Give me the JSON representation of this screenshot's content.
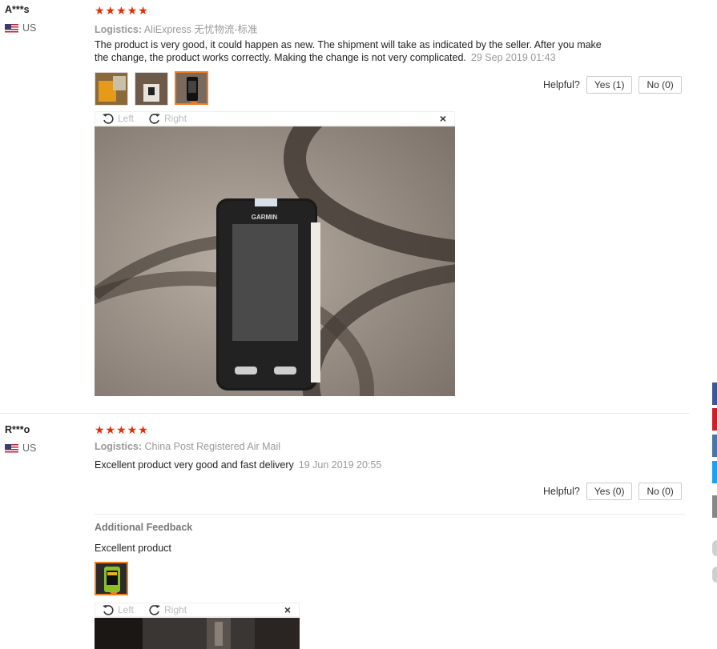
{
  "reviews": [
    {
      "user": "A***s",
      "country": "US",
      "stars": "★★★★★",
      "logistics_label": "Logistics:",
      "logistics_value": "AliExpress 无忧物流-标准",
      "text_line1": "The product is very good, it could happen as new. The shipment will take as indicated by the seller. After you make",
      "text_line2": "the change, the product works correctly. Making the change is not very complicated.",
      "date": "29 Sep 2019 01:43",
      "helpful_label": "Helpful?",
      "yes_label": "Yes (1)",
      "no_label": "No (0)",
      "rotate_left": "Left",
      "rotate_right": "Right",
      "close": "×"
    },
    {
      "user": "R***o",
      "country": "US",
      "stars": "★★★★★",
      "logistics_label": "Logistics:",
      "logistics_value": "China Post Registered Air Mail",
      "text": "Excellent product very good and fast delivery",
      "date": "19 Jun 2019 20:55",
      "helpful_label": "Helpful?",
      "yes_label": "Yes (0)",
      "no_label": "No (0)",
      "additional_title": "Additional Feedback",
      "additional_text": "Excellent product",
      "rotate_left": "Left",
      "rotate_right": "Right",
      "close": "×"
    }
  ],
  "device_brand": "GARMIN",
  "colors": {
    "star": "#e62e04",
    "active_thumb_border": "#f47c20",
    "share_facebook": "#3b5998",
    "share_pinterest": "#cb2027",
    "share_vk": "#4c75a3",
    "share_twitter": "#1da1f2",
    "share_other": "#888888"
  }
}
